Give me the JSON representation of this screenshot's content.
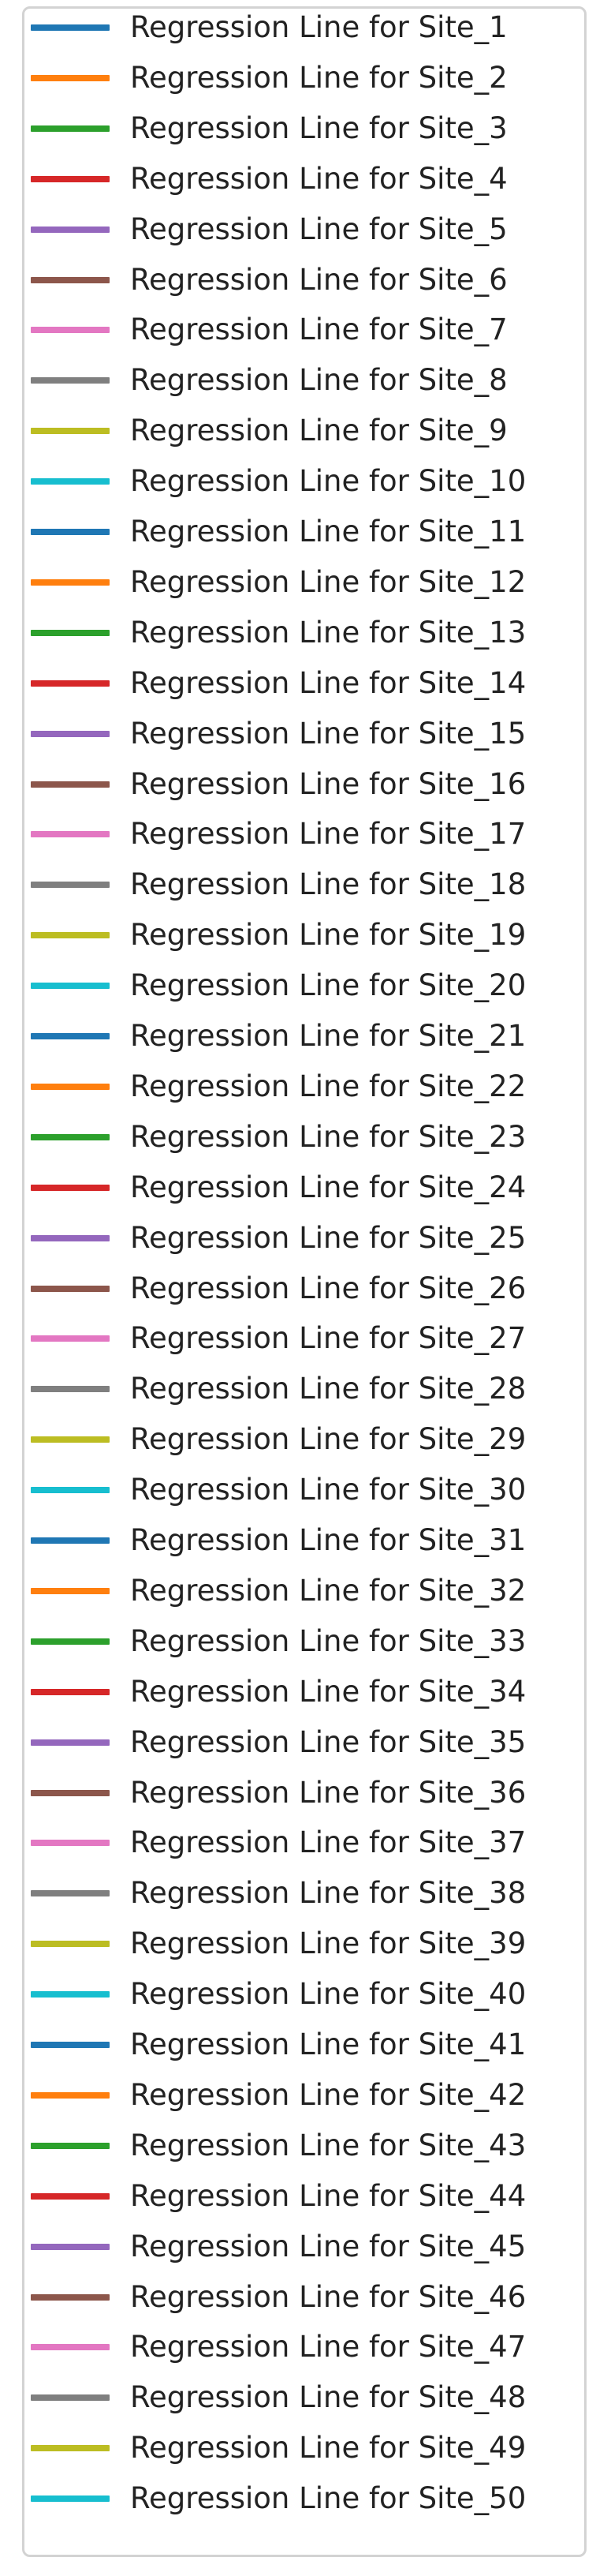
{
  "chart_data": {
    "type": "line",
    "legend_placement": "full-figure",
    "series": [
      {
        "name": "Regression Line for Site_1",
        "color": "#1f77b4"
      },
      {
        "name": "Regression Line for Site_2",
        "color": "#ff7f0e"
      },
      {
        "name": "Regression Line for Site_3",
        "color": "#2ca02c"
      },
      {
        "name": "Regression Line for Site_4",
        "color": "#d62728"
      },
      {
        "name": "Regression Line for Site_5",
        "color": "#9467bd"
      },
      {
        "name": "Regression Line for Site_6",
        "color": "#8c564b"
      },
      {
        "name": "Regression Line for Site_7",
        "color": "#e377c2"
      },
      {
        "name": "Regression Line for Site_8",
        "color": "#7f7f7f"
      },
      {
        "name": "Regression Line for Site_9",
        "color": "#bcbd22"
      },
      {
        "name": "Regression Line for Site_10",
        "color": "#17becf"
      },
      {
        "name": "Regression Line for Site_11",
        "color": "#1f77b4"
      },
      {
        "name": "Regression Line for Site_12",
        "color": "#ff7f0e"
      },
      {
        "name": "Regression Line for Site_13",
        "color": "#2ca02c"
      },
      {
        "name": "Regression Line for Site_14",
        "color": "#d62728"
      },
      {
        "name": "Regression Line for Site_15",
        "color": "#9467bd"
      },
      {
        "name": "Regression Line for Site_16",
        "color": "#8c564b"
      },
      {
        "name": "Regression Line for Site_17",
        "color": "#e377c2"
      },
      {
        "name": "Regression Line for Site_18",
        "color": "#7f7f7f"
      },
      {
        "name": "Regression Line for Site_19",
        "color": "#bcbd22"
      },
      {
        "name": "Regression Line for Site_20",
        "color": "#17becf"
      },
      {
        "name": "Regression Line for Site_21",
        "color": "#1f77b4"
      },
      {
        "name": "Regression Line for Site_22",
        "color": "#ff7f0e"
      },
      {
        "name": "Regression Line for Site_23",
        "color": "#2ca02c"
      },
      {
        "name": "Regression Line for Site_24",
        "color": "#d62728"
      },
      {
        "name": "Regression Line for Site_25",
        "color": "#9467bd"
      },
      {
        "name": "Regression Line for Site_26",
        "color": "#8c564b"
      },
      {
        "name": "Regression Line for Site_27",
        "color": "#e377c2"
      },
      {
        "name": "Regression Line for Site_28",
        "color": "#7f7f7f"
      },
      {
        "name": "Regression Line for Site_29",
        "color": "#bcbd22"
      },
      {
        "name": "Regression Line for Site_30",
        "color": "#17becf"
      },
      {
        "name": "Regression Line for Site_31",
        "color": "#1f77b4"
      },
      {
        "name": "Regression Line for Site_32",
        "color": "#ff7f0e"
      },
      {
        "name": "Regression Line for Site_33",
        "color": "#2ca02c"
      },
      {
        "name": "Regression Line for Site_34",
        "color": "#d62728"
      },
      {
        "name": "Regression Line for Site_35",
        "color": "#9467bd"
      },
      {
        "name": "Regression Line for Site_36",
        "color": "#8c564b"
      },
      {
        "name": "Regression Line for Site_37",
        "color": "#e377c2"
      },
      {
        "name": "Regression Line for Site_38",
        "color": "#7f7f7f"
      },
      {
        "name": "Regression Line for Site_39",
        "color": "#bcbd22"
      },
      {
        "name": "Regression Line for Site_40",
        "color": "#17becf"
      },
      {
        "name": "Regression Line for Site_41",
        "color": "#1f77b4"
      },
      {
        "name": "Regression Line for Site_42",
        "color": "#ff7f0e"
      },
      {
        "name": "Regression Line for Site_43",
        "color": "#2ca02c"
      },
      {
        "name": "Regression Line for Site_44",
        "color": "#d62728"
      },
      {
        "name": "Regression Line for Site_45",
        "color": "#9467bd"
      },
      {
        "name": "Regression Line for Site_46",
        "color": "#8c564b"
      },
      {
        "name": "Regression Line for Site_47",
        "color": "#e377c2"
      },
      {
        "name": "Regression Line for Site_48",
        "color": "#7f7f7f"
      },
      {
        "name": "Regression Line for Site_49",
        "color": "#bcbd22"
      },
      {
        "name": "Regression Line for Site_50",
        "color": "#17becf"
      }
    ]
  }
}
